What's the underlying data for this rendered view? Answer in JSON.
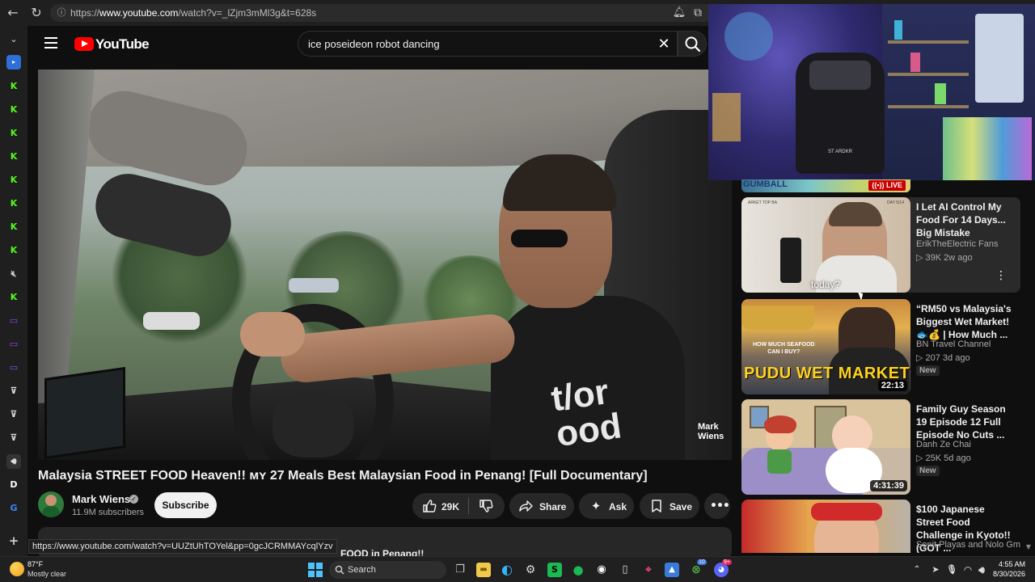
{
  "browser": {
    "url_prefix": "https://",
    "url_host": "www.youtube.com",
    "url_path": "/watch?v=_lZjm3mMl3g&t=628s",
    "status_url": "https://www.youtube.com/watch?v=UUZtUhTOYel&pp=0gcJCRMMAYcqlYzv"
  },
  "masthead": {
    "logo_text": "YouTube",
    "search_query": "ice poseideon robot dancing"
  },
  "video": {
    "title": "Malaysia STREET FOOD Heaven!! ᴍʏ 27 Meals Best Malaysian Food in Penang! [Full Documentary]",
    "watermark": "Mark\nWiens",
    "shirt_text": "t/or\nood",
    "channel": "Mark Wiens",
    "subscribers": "11.9M subscribers",
    "subscribe_label": "Subscribe",
    "likes": "29K",
    "share_label": "Share",
    "ask_label": "Ask",
    "save_label": "Save",
    "description_peek": "FOOD in Penang!!"
  },
  "webcam": {
    "chair_text": "ST ARDKR"
  },
  "live_card": {
    "brand": "GUMBALL",
    "live_label": "LIVE"
  },
  "recommendations": [
    {
      "title": "I Let AI Control My Food For 14 Days... Big Mistake",
      "channel": "ErikTheElectric Fans",
      "stats": "▷ 39K  2w ago",
      "thumb_caption": "today?",
      "thumb_corner_left": "ARKET TOP BA",
      "thumb_corner_right": "DAY 5/14"
    },
    {
      "title": "“RM50 vs Malaysia's Biggest Wet Market! 🐟💰 | How Much ...",
      "channel": "BN Travel Channel",
      "stats": "▷ 207  3d ago",
      "badge": "New",
      "duration": "22:13",
      "thumb_caption": "PUDU WET MARKET",
      "thumb_question": "HOW MUCH SEAFOOD\nCAN I BUY?"
    },
    {
      "title": "Family Guy Season 19 Episode 12 Full Episode No Cuts ...",
      "channel": "Danh Ze Chai",
      "stats": "▷ 25K  5d ago",
      "badge": "New",
      "duration": "4:31:39"
    },
    {
      "title": "$100 Japanese Street Food Challenge in Kyoto!! (GOT ...",
      "channel": "Sonit Playas and Nolo Gm..."
    }
  ],
  "taskbar": {
    "temperature": "87°F",
    "weather": "Mostly clear",
    "search_label": "Search",
    "time": "4:55 AM",
    "date": "8/30/2026",
    "badge_count": "10",
    "discord_badge": "9+"
  },
  "colors": {
    "accent": "#ff0000",
    "background": "#0f0f0f",
    "pill": "#272727"
  }
}
